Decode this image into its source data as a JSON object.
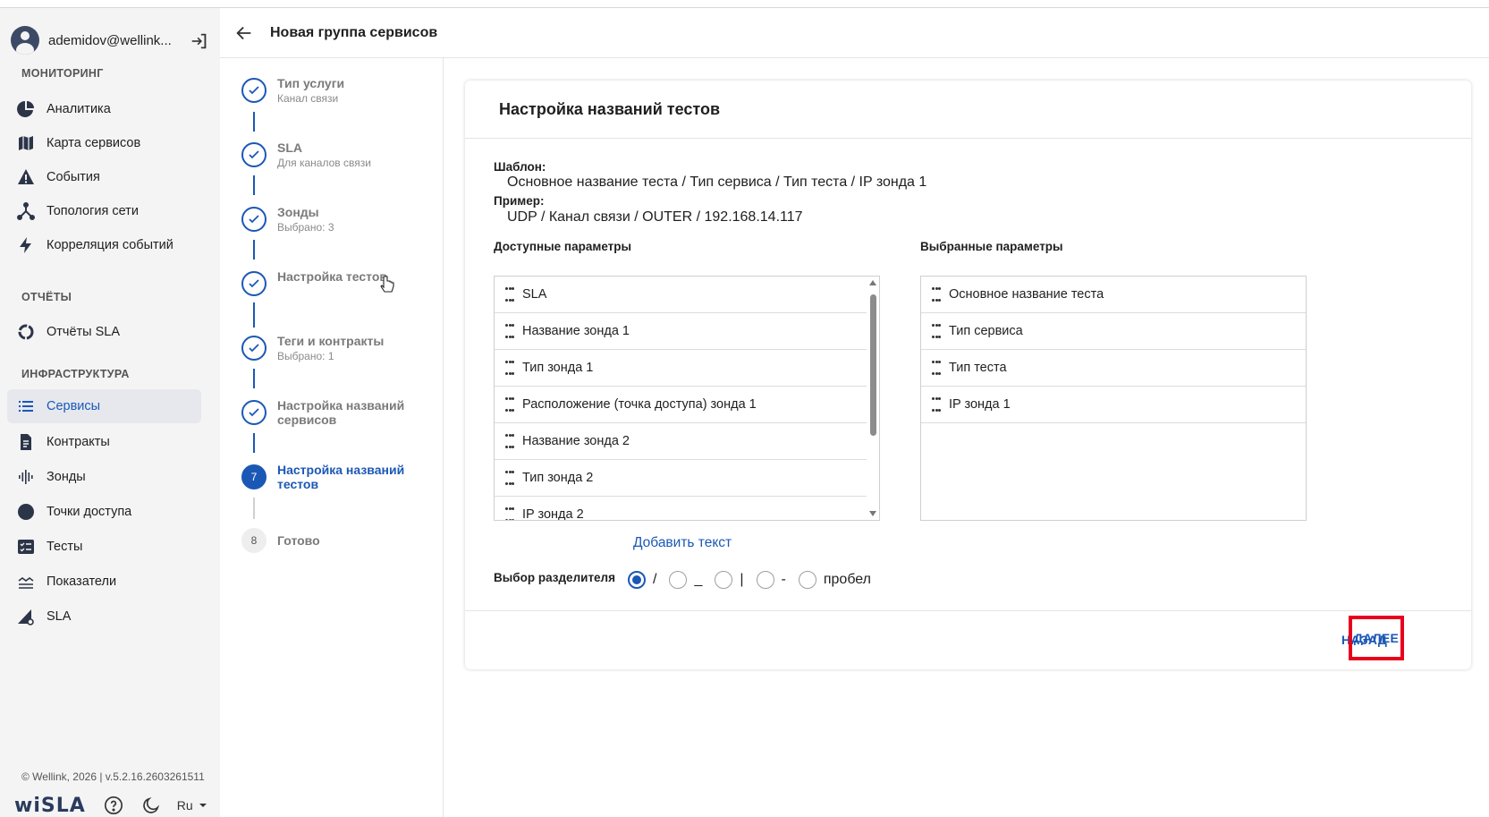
{
  "user": {
    "name": "ademidov@wellink..."
  },
  "sidebar": {
    "sections": {
      "monitoring": "МОНИТОРИНГ",
      "reports": "ОТЧЁТЫ",
      "infrastructure": "ИНФРАСТРУКТУРА"
    },
    "items": {
      "analytics": "Аналитика",
      "service_map": "Карта сервисов",
      "events": "События",
      "topology": "Топология сети",
      "correlation": "Корреляция событий",
      "sla_reports": "Отчёты SLA",
      "services": "Сервисы",
      "contracts": "Контракты",
      "probes": "Зонды",
      "access_points": "Точки доступа",
      "tests": "Тесты",
      "metrics": "Показатели",
      "sla": "SLA"
    },
    "copyright": "© Wellink, 2026 | v.5.2.16.2603261511",
    "logo": "wiSLA",
    "lang": "Ru"
  },
  "header": {
    "title": "Новая группа сервисов"
  },
  "steps": [
    {
      "title": "Тип услуги",
      "sub": "Канал связи"
    },
    {
      "title": "SLA",
      "sub": "Для каналов связи"
    },
    {
      "title": "Зонды",
      "sub": "Выбрано: 3"
    },
    {
      "title": "Настройка тестов",
      "sub": ""
    },
    {
      "title": "Теги и контракты",
      "sub": "Выбрано: 1"
    },
    {
      "title": "Настройка названий сервисов",
      "title_line1": "Настройка названий",
      "title_line2": "сервисов"
    },
    {
      "number": "7",
      "title_line1": "Настройка названий",
      "title_line2": "тестов"
    },
    {
      "number": "8",
      "title": "Готово"
    }
  ],
  "card": {
    "title": "Настройка названий тестов",
    "template_label": "Шаблон:",
    "template_value": "Основное название теста / Тип сервиса / Тип теста / IP зонда 1",
    "example_label": "Пример:",
    "example_value": "UDP / Канал связи / OUTER / 192.168.14.117",
    "available_label": "Доступные параметры",
    "selected_label": "Выбранные параметры",
    "available": [
      "SLA",
      "Название зонда 1",
      "Тип зонда 1",
      "Расположение (точка доступа) зонда 1",
      "Название зонда 2",
      "Тип зонда 2",
      "IP зонда 2"
    ],
    "selected": [
      "Основное название теста",
      "Тип сервиса",
      "Тип теста",
      "IP зонда 1"
    ],
    "add_text": "Добавить текст",
    "separator_label": "Выбор разделителя",
    "separators": [
      {
        "label": "/",
        "checked": true
      },
      {
        "label": "_",
        "checked": false
      },
      {
        "label": "|",
        "checked": false
      },
      {
        "label": "-",
        "checked": false
      },
      {
        "label": "пробел",
        "checked": false
      }
    ],
    "back": "НАЗАД",
    "next": "ДАЛЕЕ"
  },
  "colors": {
    "accent": "#1b58b5",
    "highlight": "#e8001c"
  }
}
